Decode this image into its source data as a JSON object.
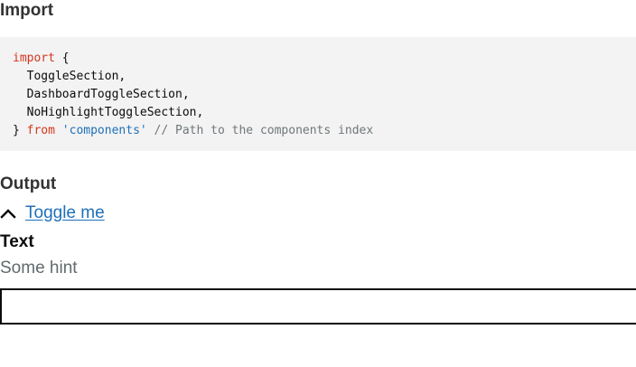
{
  "import_section": {
    "heading": "Import",
    "code": {
      "line1_keyword": "import",
      "line1_rest": " {",
      "line2": "  ToggleSection,",
      "line3": "  DashboardToggleSection,",
      "line4": "  NoHighlightToggleSection,",
      "line5_brace": "} ",
      "line5_keyword": "from",
      "line5_space": " ",
      "line5_string": "'components'",
      "line5_comment": " // Path to the components index"
    }
  },
  "output_section": {
    "heading": "Output",
    "toggle": {
      "icon": "chevron-up-icon",
      "label": "Toggle me"
    },
    "field": {
      "label": "Text",
      "hint": "Some hint",
      "value": ""
    }
  },
  "colors": {
    "keyword": "#d4351c",
    "string": "#1d70b8",
    "comment": "#6f777b",
    "link": "#1d70b8",
    "hint": "#626a6e",
    "code_background": "#f3f3f3"
  }
}
